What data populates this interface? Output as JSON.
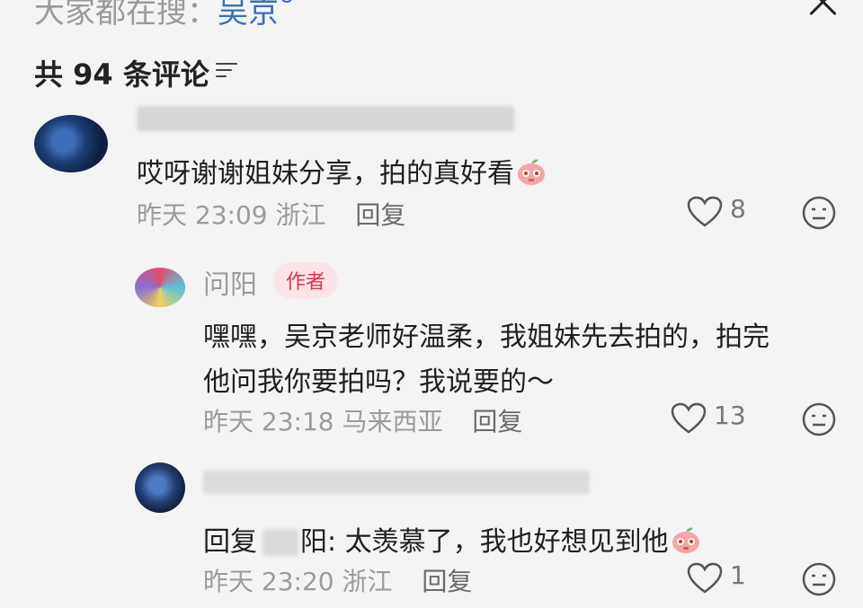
{
  "search_hint": {
    "prefix": "大家都在搜：",
    "term": "吴京"
  },
  "comments_header": {
    "title": "共 94 条评论"
  },
  "comments": [
    {
      "text": "哎呀谢谢姐妹分享，拍的真好看",
      "time": "昨天 23:09",
      "location": "浙江",
      "reply_label": "回复",
      "likes": "8"
    },
    {
      "author": "问阳",
      "badge": "作者",
      "text_line1": "嘿嘿，吴京老师好温柔，我姐妹先去拍的，拍完",
      "text_line2": "他问我你要拍吗？我说要的～",
      "time": "昨天 23:18",
      "location": "马来西亚",
      "reply_label": "回复",
      "likes": "13"
    },
    {
      "reply_prefix": "回复",
      "reply_target_tail": "阳",
      "text": ": 太羡慕了，我也好想见到他",
      "time": "昨天 23:20",
      "location": "浙江",
      "reply_label": "回复",
      "likes": "1"
    }
  ],
  "icons": [
    "search-icon",
    "close-icon",
    "filter-icon",
    "heart-icon",
    "dislike-face-icon",
    "peach-emoji-icon"
  ],
  "colors": {
    "accent": "#3a6fb5",
    "author_badge_bg": "#fbe4e8",
    "author_badge_text": "#d9344d"
  }
}
